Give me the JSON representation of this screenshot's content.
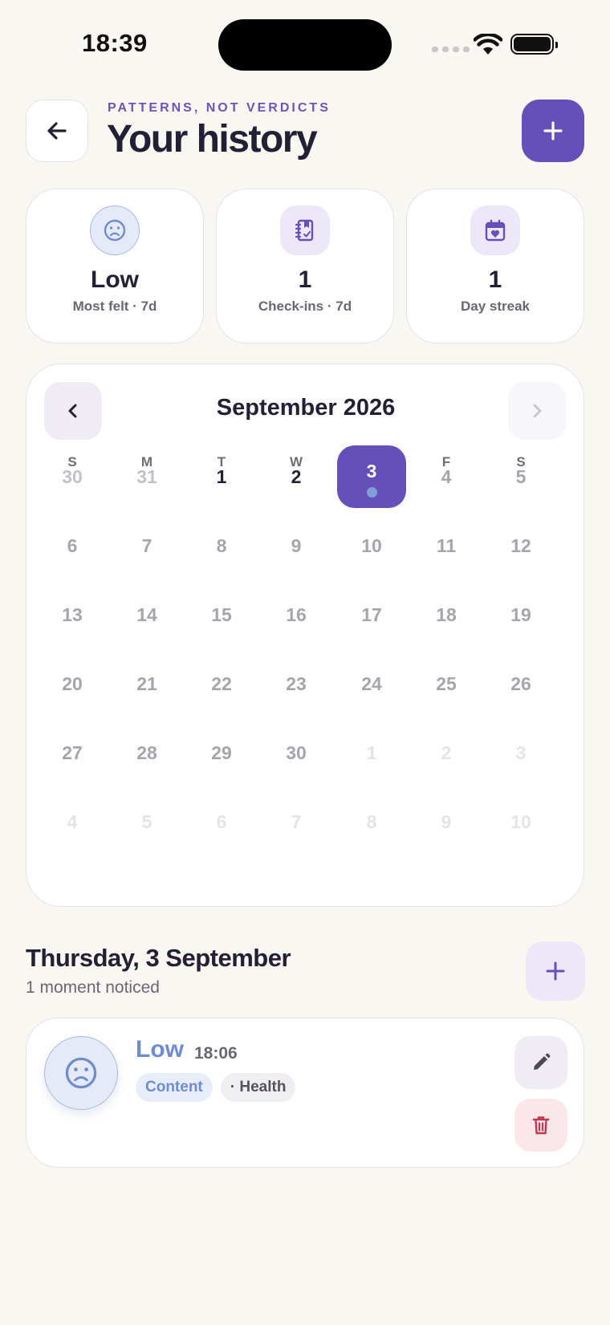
{
  "status_bar": {
    "time": "18:39"
  },
  "header": {
    "eyebrow": "PATTERNS, NOT VERDICTS",
    "title": "Your history"
  },
  "stats": [
    {
      "icon": "sad-face-icon",
      "value": "Low",
      "label": "Most felt · 7d"
    },
    {
      "icon": "journal-icon",
      "value": "1",
      "label": "Check-ins · 7d"
    },
    {
      "icon": "calendar-heart-icon",
      "value": "1",
      "label": "Day streak"
    }
  ],
  "calendar": {
    "month_label": "September 2026",
    "weekdays": [
      "S",
      "M",
      "T",
      "W",
      "T",
      "F",
      "S"
    ],
    "selected_day": "3",
    "days_with_entries": [
      "3"
    ],
    "weeks": [
      [
        "30",
        "31",
        "1",
        "2",
        "3",
        "4",
        "5"
      ],
      [
        "6",
        "7",
        "8",
        "9",
        "10",
        "11",
        "12"
      ],
      [
        "13",
        "14",
        "15",
        "16",
        "17",
        "18",
        "19"
      ],
      [
        "20",
        "21",
        "22",
        "23",
        "24",
        "25",
        "26"
      ],
      [
        "27",
        "28",
        "29",
        "30",
        "1",
        "2",
        "3"
      ],
      [
        "4",
        "5",
        "6",
        "7",
        "8",
        "9",
        "10"
      ]
    ],
    "states": [
      [
        "faded",
        "faded",
        "past",
        "past",
        "selected",
        "future",
        "future"
      ],
      [
        "future",
        "future",
        "future",
        "future",
        "future",
        "future",
        "future"
      ],
      [
        "future",
        "future",
        "future",
        "future",
        "future",
        "future",
        "future"
      ],
      [
        "future",
        "future",
        "future",
        "future",
        "future",
        "future",
        "future"
      ],
      [
        "future",
        "future",
        "future",
        "future",
        "out",
        "out",
        "out"
      ],
      [
        "out",
        "out",
        "out",
        "out",
        "out",
        "out",
        "out"
      ]
    ]
  },
  "day_section": {
    "title": "Thursday, 3 September",
    "subtitle": "1 moment noticed"
  },
  "entries": [
    {
      "mood": "Low",
      "time": "18:06",
      "icon": "sad-face-icon",
      "tags": [
        "Content",
        "· Health"
      ]
    }
  ],
  "colors": {
    "accent": "#6550b9",
    "background": "#f9f7f2",
    "mood_low": "#6f8ccf",
    "delete": "#c0394f"
  }
}
